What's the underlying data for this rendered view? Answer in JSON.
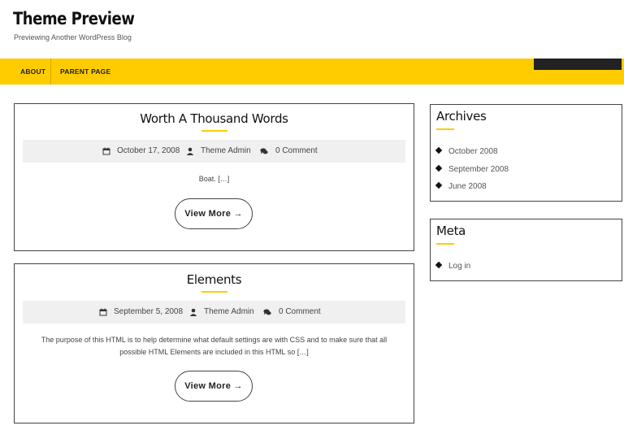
{
  "header": {
    "site_title": "Theme Preview",
    "site_description": "Previewing Another WordPress Blog"
  },
  "nav": {
    "items": [
      {
        "label": "ABOUT"
      },
      {
        "label": "PARENT PAGE"
      }
    ]
  },
  "posts": [
    {
      "title": "Worth A Thousand Words",
      "date": "October 17, 2008",
      "author": "Theme Admin",
      "comments": "0 Comment",
      "excerpt": "Boat. […]",
      "button_label": "View More →"
    },
    {
      "title": "Elements",
      "date": "September 5, 2008",
      "author": "Theme Admin",
      "comments": "0 Comment",
      "excerpt": "The purpose of this HTML is to help determine what default settings are with CSS and to make sure that all possible HTML Elements are included in this HTML so […]",
      "button_label": "View More →"
    }
  ],
  "sidebar": {
    "archives": {
      "title": "Archives",
      "items": [
        "October 2008",
        "September 2008",
        "June 2008"
      ]
    },
    "meta": {
      "title": "Meta",
      "items": [
        "Log in"
      ]
    }
  },
  "icons": {
    "date": "calendar-icon",
    "author": "user-icon",
    "comments": "comments-icon",
    "list_bullet": "diamond-icon"
  },
  "colors": {
    "accent": "#ffcc00",
    "search_box": "#222222",
    "meta_band": "#f0f0f0",
    "border": "#444444"
  }
}
